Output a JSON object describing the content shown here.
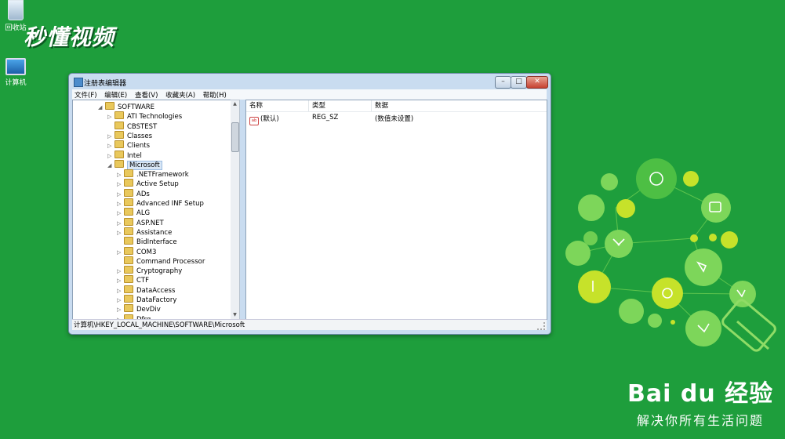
{
  "desktop": {
    "recycle_label": "回收站",
    "computer_label": "计算机",
    "watermark": "秒懂视频"
  },
  "window": {
    "title": "注册表编辑器",
    "controls": {
      "minimize": "–",
      "maximize": "□",
      "close": "✕"
    },
    "menu": [
      "文件(F)",
      "编辑(E)",
      "查看(V)",
      "收藏夹(A)",
      "帮助(H)"
    ],
    "tree": [
      {
        "label": "SOFTWARE",
        "level": 0,
        "expander": "◢"
      },
      {
        "label": "ATI Technologies",
        "level": 1,
        "expander": "▷"
      },
      {
        "label": "CBSTEST",
        "level": 1,
        "expander": ""
      },
      {
        "label": "Classes",
        "level": 1,
        "expander": "▷"
      },
      {
        "label": "Clients",
        "level": 1,
        "expander": "▷"
      },
      {
        "label": "Intel",
        "level": 1,
        "expander": "▷"
      },
      {
        "label": "Microsoft",
        "level": 1,
        "expander": "◢",
        "selected": true
      },
      {
        "label": ".NETFramework",
        "level": 2,
        "expander": "▷"
      },
      {
        "label": "Active Setup",
        "level": 2,
        "expander": "▷"
      },
      {
        "label": "ADs",
        "level": 2,
        "expander": "▷"
      },
      {
        "label": "Advanced INF Setup",
        "level": 2,
        "expander": "▷"
      },
      {
        "label": "ALG",
        "level": 2,
        "expander": "▷"
      },
      {
        "label": "ASP.NET",
        "level": 2,
        "expander": "▷"
      },
      {
        "label": "Assistance",
        "level": 2,
        "expander": "▷"
      },
      {
        "label": "BidInterface",
        "level": 2,
        "expander": ""
      },
      {
        "label": "COM3",
        "level": 2,
        "expander": "▷"
      },
      {
        "label": "Command Processor",
        "level": 2,
        "expander": ""
      },
      {
        "label": "Cryptography",
        "level": 2,
        "expander": "▷"
      },
      {
        "label": "CTF",
        "level": 2,
        "expander": "▷"
      },
      {
        "label": "DataAccess",
        "level": 2,
        "expander": "▷"
      },
      {
        "label": "DataFactory",
        "level": 2,
        "expander": "▷"
      },
      {
        "label": "DevDiv",
        "level": 2,
        "expander": "▷"
      },
      {
        "label": "Dfrg",
        "level": 2,
        "expander": "▷"
      }
    ],
    "list": {
      "headers": [
        "名称",
        "类型",
        "数据"
      ],
      "rows": [
        {
          "icon": "ab",
          "name": "(默认)",
          "type": "REG_SZ",
          "data": "(数值未设置)"
        }
      ]
    },
    "status": "计算机\\HKEY_LOCAL_MACHINE\\SOFTWARE\\Microsoft"
  },
  "branding": {
    "logo": "Bai du 经验",
    "slogan": "解决你所有生活问题"
  },
  "colors": {
    "desktop": "#1e9e3c",
    "bulb_light": "#7dd65a",
    "bulb_accent": "#c6e22a",
    "selection": "#d8e6f5"
  },
  "icons": [
    "recycle-bin-icon",
    "computer-icon",
    "registry-icon",
    "folder-icon",
    "string-value-icon",
    "size-grip-icon"
  ]
}
